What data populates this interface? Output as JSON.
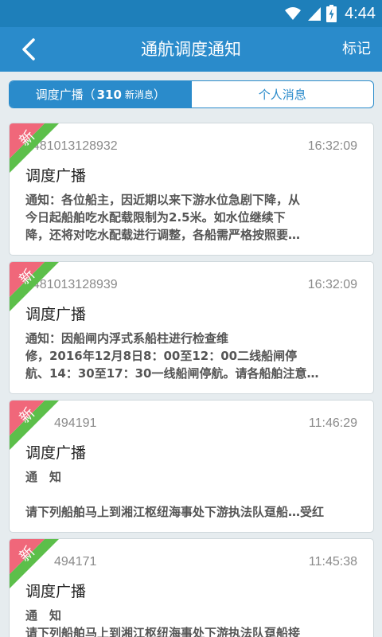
{
  "status_bar": {
    "time": "4:44"
  },
  "header": {
    "title": "通航调度通知",
    "mark_label": "标记"
  },
  "tabs": {
    "broadcast": {
      "label": "调度广播",
      "count": "310",
      "new_label": "新消息"
    },
    "personal": {
      "label": "个人消息"
    }
  },
  "new_badge": "新",
  "messages": [
    {
      "id": "1481013128932",
      "time": "16:32:09",
      "title": "调度广播",
      "lines": [
        "通知：各位船主，因近期以来下游水位急剧下降，从",
        "今日起船舶吃水配载限制为2.5米。如水位继续下",
        "降，还将对吃水配载进行调整，各船需严格按照要…"
      ]
    },
    {
      "id": "1481013128939",
      "time": "16:32:09",
      "title": "调度广播",
      "lines": [
        "通知：因船闸内浮式系船柱进行检查维",
        "修，2016年12月8日8：00至12：00二线船闸停",
        "航、14：30至17：30一线船闸停航。请各船舶注意…"
      ]
    },
    {
      "id": "494191",
      "time": "11:46:29",
      "title": "调度广播",
      "lines": [
        "通　知",
        "",
        "请下列船舶马上到湘江枢纽海事处下游执法队趸船…受红"
      ]
    },
    {
      "id": "494171",
      "time": "11:45:38",
      "title": "调度广播",
      "lines": [
        "通　知",
        "请下列船舶马上到湘江枢纽海事处下游执法队趸船接"
      ]
    }
  ],
  "colors": {
    "primary": "#2a8bcb",
    "status_bar": "#1e7fba",
    "ribbon_red": "#f0677a",
    "ribbon_green": "#5cbf4a",
    "background": "#e6ecef"
  }
}
